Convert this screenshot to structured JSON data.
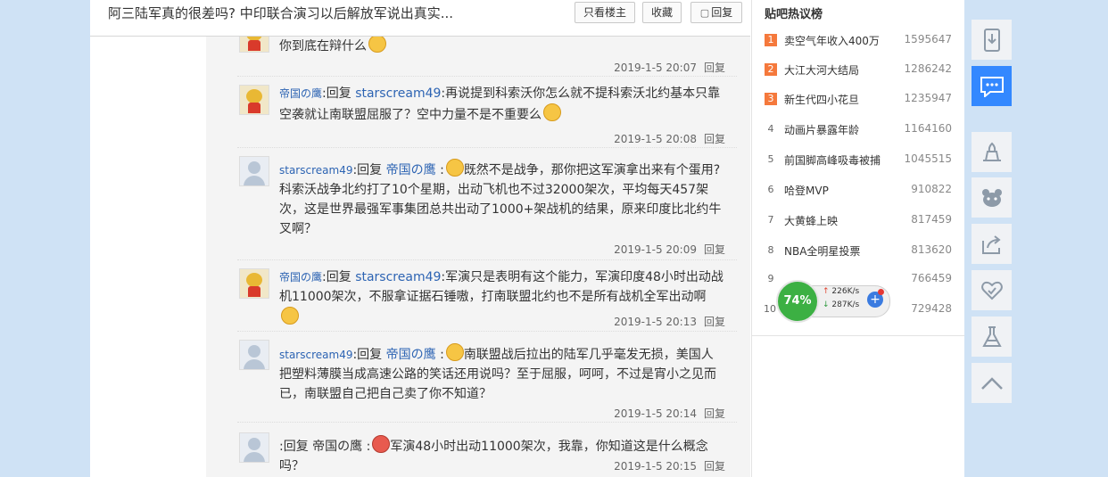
{
  "header": {
    "thread_title": "阿三陆军真的很差吗? 中印联合演习以后解放军说出真实...",
    "buttons": {
      "only_op": "只看楼主",
      "favorite": "收藏",
      "reply": "回复"
    }
  },
  "replies": [
    {
      "avatar": "pooh-avatar",
      "segments": [
        {
          "text": "你到底在辩什么",
          "type": "text"
        }
      ],
      "emoji": true,
      "time": "2019-1-5 20:07",
      "reply_label": "回复"
    },
    {
      "avatar": "pooh-avatar",
      "author": "帝国の鹰",
      "reply_word": ":回复",
      "target": "starscream49",
      "body": ":再说提到科索沃你怎么就不提科索沃北约基本只靠空袭就让南联盟屈服了？空中力量不是不重要么",
      "time": "2019-1-5 20:08",
      "reply_label": "回复"
    },
    {
      "avatar": "default-avatar",
      "author": "starscream49",
      "reply_word": ":回复",
      "target": "帝国の鹰",
      "body": "既然不是战争，那你把这军演拿出来有个蛋用?科索沃战争北约打了10个星期，出动飞机也不过32000架次，平均每天457架次，这是世界最强军事集团总共出动了1000+架战机的结果，原来印度比北约牛叉啊？",
      "time": "2019-1-5 20:09",
      "reply_label": "回复"
    },
    {
      "avatar": "pooh-avatar",
      "author": "帝国の鹰",
      "reply_word": ":回复",
      "target": "starscream49",
      "body": ":军演只是表明有这个能力，军演印度48小时出动战机11000架次，不服拿证据石锤嗷，打南联盟北约也不是所有战机全军出动啊",
      "time": "2019-1-5 20:13",
      "reply_label": "回复"
    },
    {
      "avatar": "default-avatar",
      "author": "starscream49",
      "reply_word": ":回复",
      "target": "帝国の鹰",
      "body": "南联盟战后拉出的陆军几乎毫发无损，美国人把塑料薄膜当成高速公路的笑话还用说吗？至于屈服，呵呵，不过是宵小之见而已，南联盟自己把自己卖了你不知道？",
      "time": "2019-1-5 20:14",
      "reply_label": "回复"
    },
    {
      "avatar": "default-avatar",
      "author": "",
      "reply_word": ":回复",
      "target": "帝国の鹰",
      "body": "军演48小时出动11000架次，我靠，你知道这是什么概念吗？",
      "time": "2019-1-5 20:15",
      "reply_label": "回复"
    }
  ],
  "hot_list": {
    "title": "贴吧热议榜",
    "items": [
      {
        "rank": "1",
        "name": "卖空气年收入400万",
        "count": "1595647"
      },
      {
        "rank": "2",
        "name": "大江大河大结局",
        "count": "1286242"
      },
      {
        "rank": "3",
        "name": "新生代四小花旦",
        "count": "1235947"
      },
      {
        "rank": "4",
        "name": "动画片暴露年龄",
        "count": "1164160"
      },
      {
        "rank": "5",
        "name": "前国脚高峰吸毒被捕",
        "count": "1045515"
      },
      {
        "rank": "6",
        "name": "哈登MVP",
        "count": "910822"
      },
      {
        "rank": "7",
        "name": "大黄蜂上映",
        "count": "817459"
      },
      {
        "rank": "8",
        "name": "NBA全明星投票",
        "count": "813620"
      },
      {
        "rank": "9",
        "name": "",
        "count": "766459"
      },
      {
        "rank": "10",
        "name": "",
        "count": "729428"
      }
    ],
    "top_color": "#f5793c"
  },
  "net_widget": {
    "percent": "74%",
    "up": "226K/s",
    "down": "287K/s"
  },
  "toolbar": [
    "download-app-icon",
    "message-icon",
    "magic-hat-icon",
    "tieba-bear-icon",
    "share-icon",
    "like-heart-icon",
    "lab-flask-icon",
    "back-to-top-icon"
  ],
  "colors": {
    "accent": "#3388ff",
    "link": "#2d64b3",
    "background": "#cfe2f5"
  }
}
